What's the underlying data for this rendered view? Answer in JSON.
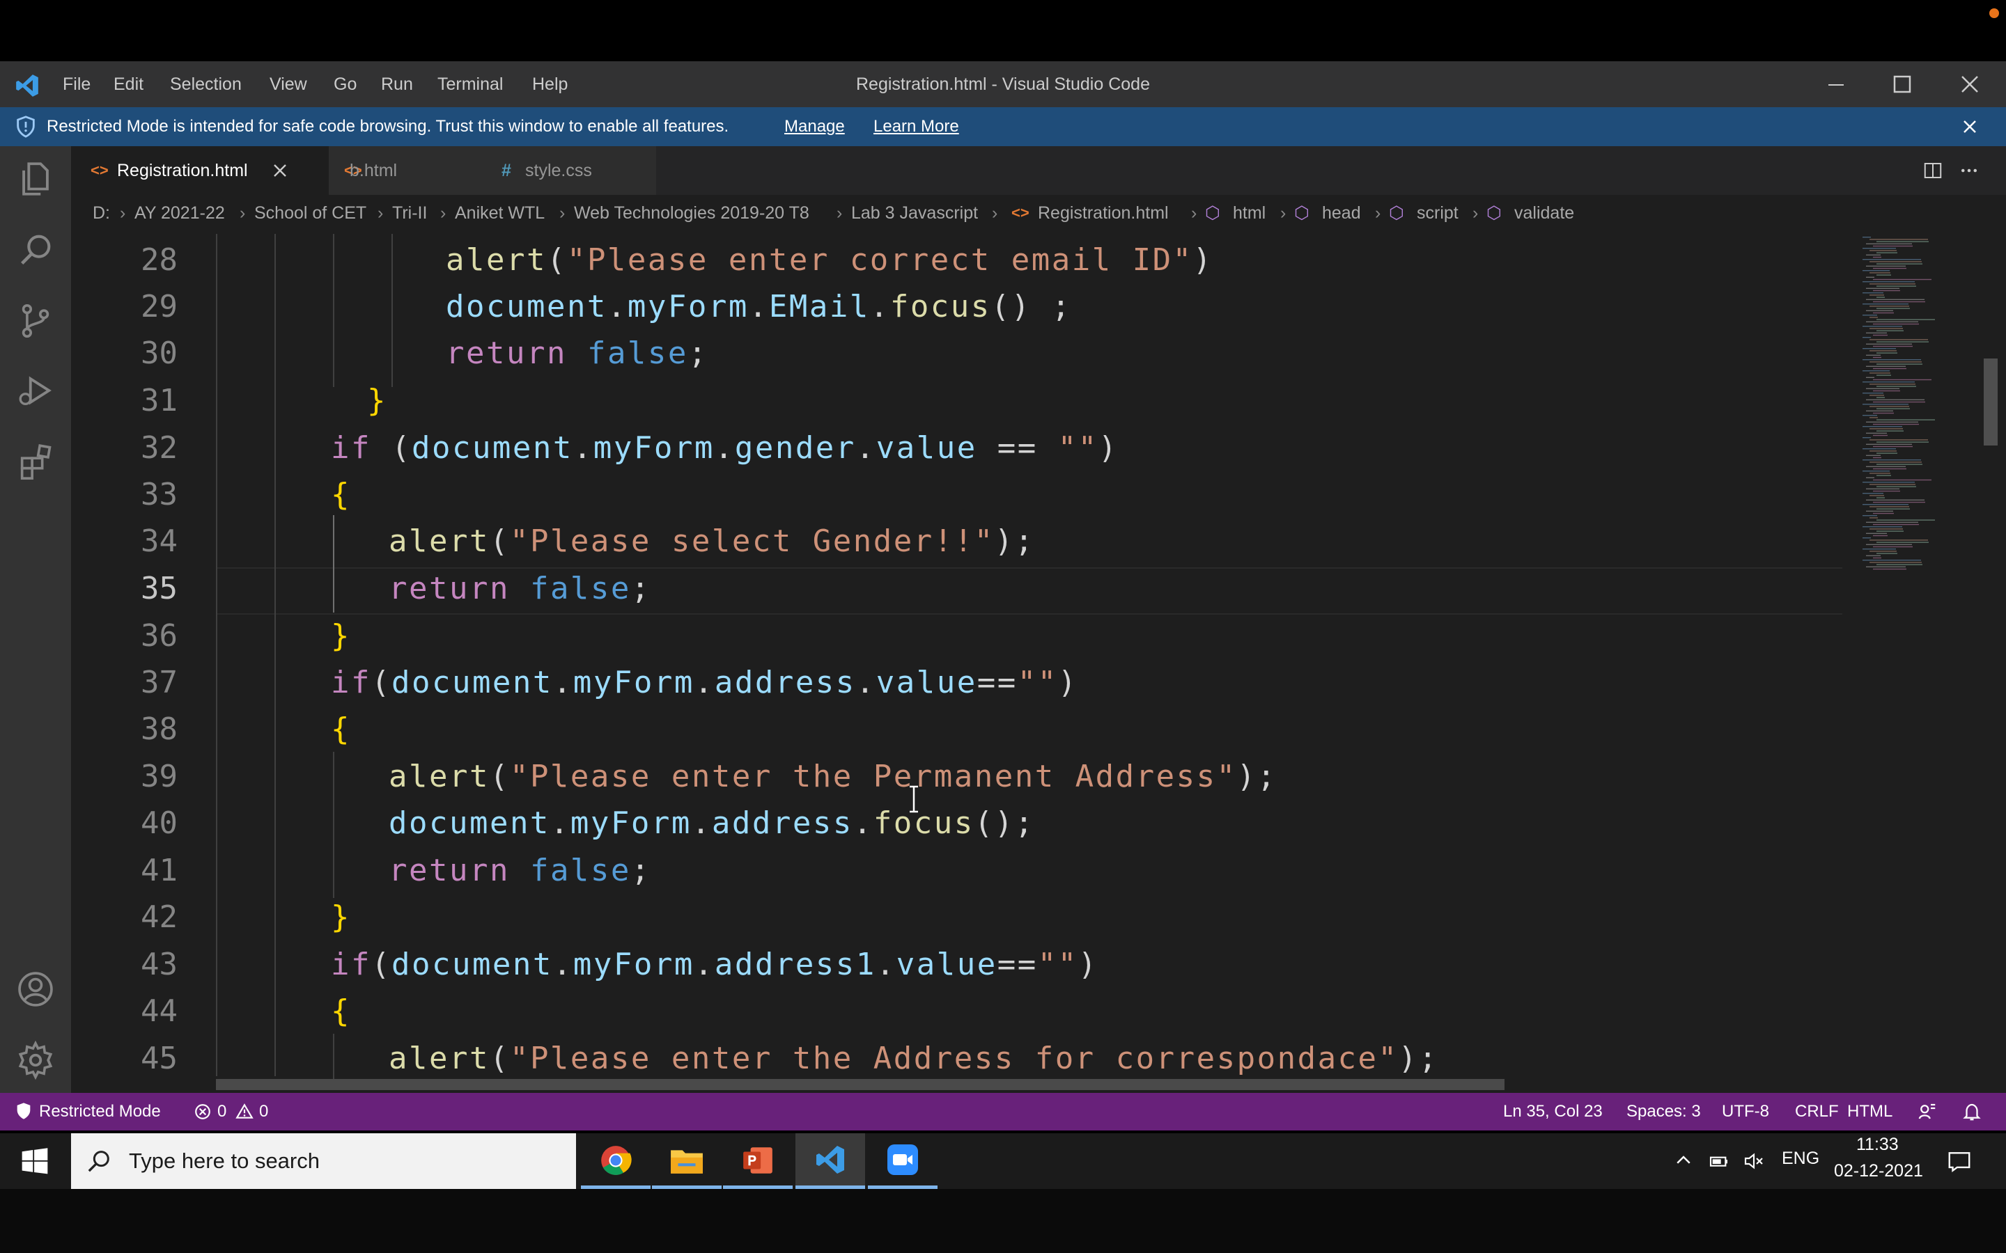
{
  "window": {
    "title": "Registration.html - Visual Studio Code",
    "menu": [
      "File",
      "Edit",
      "Selection",
      "View",
      "Go",
      "Run",
      "Terminal",
      "Help"
    ]
  },
  "banner": {
    "text": "Restricted Mode is intended for safe code browsing. Trust this window to enable all features.",
    "manage": "Manage",
    "learn_more": "Learn More"
  },
  "tabs": [
    {
      "label": "Registration.html",
      "icon": "<>",
      "active": true
    },
    {
      "label": "b.html",
      "icon": "<>",
      "active": false
    },
    {
      "label": "style.css",
      "icon": "#",
      "active": false
    }
  ],
  "breadcrumb": [
    "D:",
    "AY 2021-22",
    "School of CET",
    "Tri-II",
    "Aniket WTL",
    "Web Technologies 2019-20 T8",
    "Lab 3 Javascript",
    "Registration.html",
    "html",
    "head",
    "script",
    "validate"
  ],
  "code": {
    "line_numbers": [
      "28",
      "29",
      "30",
      "31",
      "32",
      "33",
      "34",
      "35",
      "36",
      "37",
      "38",
      "39",
      "40",
      "41",
      "42",
      "43",
      "44",
      "45"
    ],
    "current_line": "35"
  },
  "status": {
    "restricted": "Restricted Mode",
    "errors": "0",
    "warnings": "0",
    "position": "Ln 35, Col 23",
    "spaces": "Spaces: 3",
    "encoding": "UTF-8",
    "eol": "CRLF",
    "language": "HTML"
  },
  "taskbar": {
    "search_placeholder": "Type here to search",
    "lang": "ENG",
    "time": "11:33",
    "date": "02-12-2021"
  },
  "colors": {
    "status_bar": "#68217a",
    "banner": "#1f4d7a",
    "editor_bg": "#1e1e1e"
  }
}
